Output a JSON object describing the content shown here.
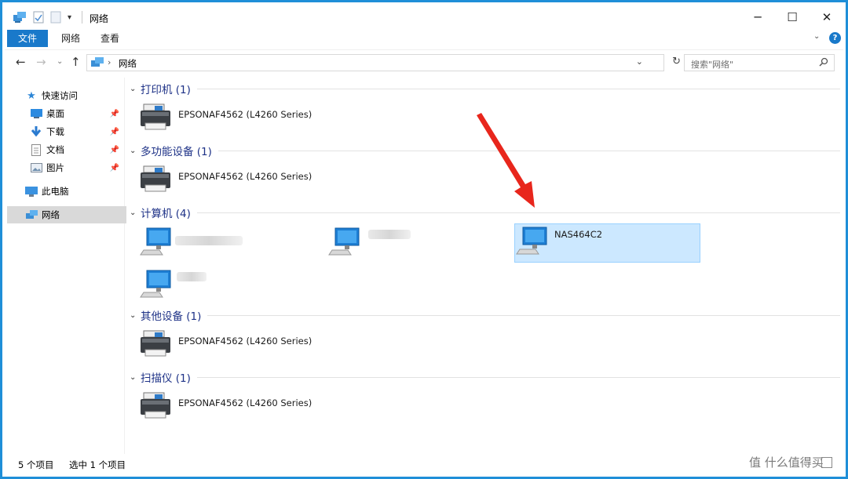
{
  "window": {
    "title": "网络",
    "controls": {
      "minimize": "─",
      "maximize": "☐",
      "close": "✕"
    }
  },
  "ribbon": {
    "tabs": [
      {
        "label": "文件"
      },
      {
        "label": "网络"
      },
      {
        "label": "查看"
      }
    ],
    "help_glyph": "?"
  },
  "address": {
    "path": "网络",
    "separator": "›",
    "search_placeholder": "搜索\"网络\""
  },
  "nav": {
    "quick_access": "快速访问",
    "items": [
      {
        "label": "桌面"
      },
      {
        "label": "下载"
      },
      {
        "label": "文档"
      },
      {
        "label": "图片"
      }
    ],
    "this_pc": "此电脑",
    "network": "网络"
  },
  "groups": [
    {
      "title": "打印机 (1)",
      "items": [
        {
          "label": "EPSONAF4562 (L4260 Series)"
        }
      ]
    },
    {
      "title": "多功能设备 (1)",
      "items": [
        {
          "label": "EPSONAF4562 (L4260 Series)"
        }
      ]
    },
    {
      "title": "计算机 (4)",
      "items": [
        {
          "label": ""
        },
        {
          "label": ""
        },
        {
          "label": "NAS464C2"
        },
        {
          "label": ""
        }
      ]
    },
    {
      "title": "其他设备 (1)",
      "items": [
        {
          "label": "EPSONAF4562 (L4260 Series)"
        }
      ]
    },
    {
      "title": "扫描仪 (1)",
      "items": [
        {
          "label": "EPSONAF4562 (L4260 Series)"
        }
      ]
    }
  ],
  "status": {
    "count": "5 个项目",
    "selected": "选中 1 个项目"
  },
  "watermark": "值 什么值得买",
  "colors": {
    "accent": "#1979ca",
    "border": "#1f8fd8",
    "group_title": "#1e3287",
    "selection": "#cce8ff",
    "arrow": "#e8261c"
  }
}
